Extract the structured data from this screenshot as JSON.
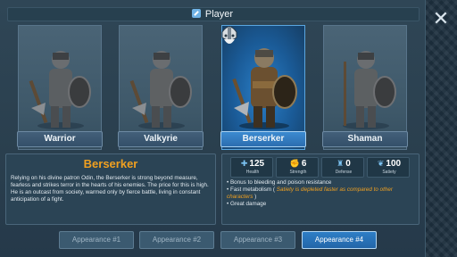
{
  "header": {
    "title": "Player"
  },
  "close": {
    "icon": "close-icon",
    "glyph": "✕"
  },
  "characters": [
    {
      "label": "Warrior",
      "selected": false
    },
    {
      "label": "Valkyrie",
      "selected": false
    },
    {
      "label": "Berserker",
      "selected": true
    },
    {
      "label": "Shaman",
      "selected": false
    }
  ],
  "description": {
    "title": "Berserker",
    "text": "Relying on his divine patron Odin, the Berserker is strong beyond measure, fearless and strikes terror in the hearts of his enemies. The price for this is high. He is an outcast from society, warmed only by fierce battle, living in constant anticipation of a fight."
  },
  "stats": [
    {
      "icon": "health-cross-icon",
      "glyph": "✚",
      "value": "125",
      "label": "Health"
    },
    {
      "icon": "strength-icon",
      "glyph": "6",
      "value": "6",
      "label": "Strength"
    },
    {
      "icon": "defense-icon",
      "glyph": "♜",
      "value": "0",
      "label": "Defense"
    },
    {
      "icon": "satiety-icon",
      "glyph": "❦",
      "value": "100",
      "label": "Satiety"
    }
  ],
  "traits": {
    "t1": "Bonus to bleeding and poison resistance",
    "t2_prefix": "Fast metabolism ( ",
    "t2_highlight": "Satiety is depleted faster as compared to other characters",
    "t2_suffix": " )",
    "t3": "Great damage"
  },
  "appearance_tabs": [
    {
      "label": "Appearance #1",
      "active": false
    },
    {
      "label": "Appearance #2",
      "active": false
    },
    {
      "label": "Appearance #3",
      "active": false
    },
    {
      "label": "Appearance #4",
      "active": true
    }
  ],
  "colors": {
    "accent_blue": "#2e7ec6",
    "title_orange": "#f0a020",
    "panel": "#2b4455"
  }
}
